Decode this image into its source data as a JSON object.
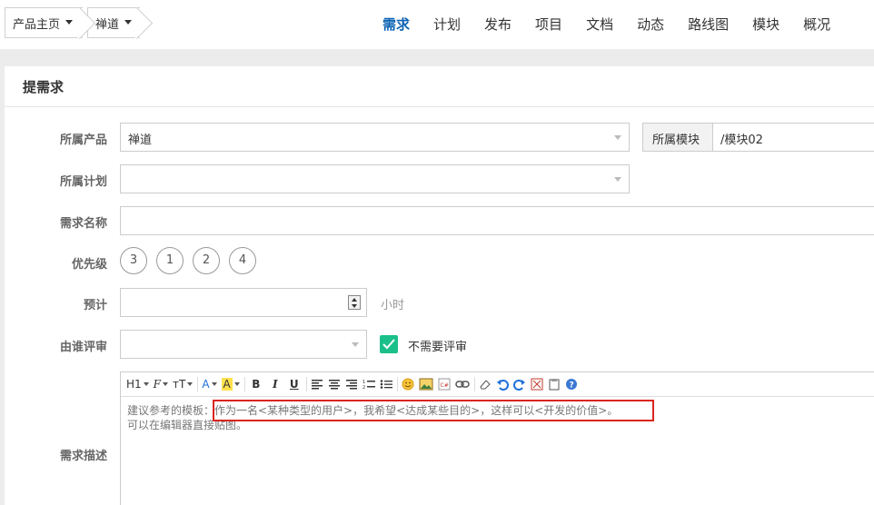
{
  "breadcrumb": {
    "product_home": "产品主页",
    "product_name": "禅道"
  },
  "nav": {
    "items": [
      "需求",
      "计划",
      "发布",
      "项目",
      "文档",
      "动态",
      "路线图",
      "模块",
      "概况"
    ],
    "active": "需求"
  },
  "page": {
    "title": "提需求"
  },
  "form": {
    "product": {
      "label": "所属产品",
      "value": "禅道"
    },
    "module": {
      "label": "所属模块",
      "value": "/模块02"
    },
    "plan": {
      "label": "所属计划",
      "value": ""
    },
    "name": {
      "label": "需求名称",
      "value": ""
    },
    "priority": {
      "label": "优先级",
      "options": [
        "3",
        "1",
        "2",
        "4"
      ]
    },
    "estimate": {
      "label": "预计",
      "value": "",
      "unit": "小时"
    },
    "reviewer": {
      "label": "由谁评审",
      "value": "",
      "no_review_label": "不需要评审",
      "no_review_checked": true
    },
    "description": {
      "label": "需求描述",
      "line1": "建议参考的模板：作为一名<某种类型的用户>，我希望<达成某些目的>，这样可以<开发的价值>。",
      "line2": "可以在编辑器直接贴图。"
    }
  },
  "toolbar": {
    "heading": "H1",
    "font": "F",
    "font_size": "тT",
    "font_color": "A",
    "bg_color": "A",
    "bold": "B",
    "italic": "I",
    "underline": "U"
  },
  "colors": {
    "accent": "#0c64b3",
    "check": "#1bbf8a",
    "highlight_box": "#d9251d"
  }
}
